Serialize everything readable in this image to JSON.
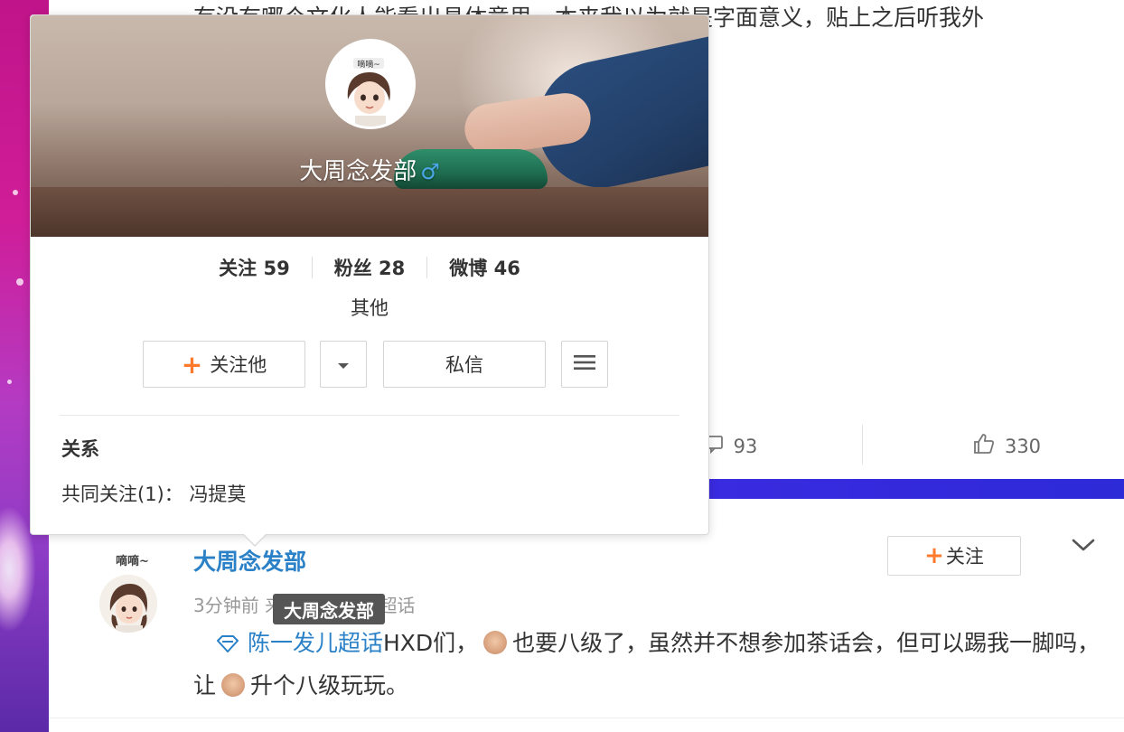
{
  "post": {
    "text_top": "有没有哪个文化人能看出具体意思，本来我以为就是字面意义，贴上之后听我外",
    "comment_count": "93",
    "like_count": "330"
  },
  "comment": {
    "avatar_tag": "嘀嘀~",
    "username": "大周念发部",
    "meta": "3分钟前 来自 陈一发儿超话",
    "tooltip": "大周念发部",
    "follow_label": "关注",
    "topic": "陈一发儿超话",
    "text_part1": "HXD们，",
    "text_part2": "也要八级了，虽然并不想参加茶话会，但可以踢我一脚吗，让",
    "text_part3": "升个八级玩玩。"
  },
  "card": {
    "avatar_tag": "嘀嘀~",
    "name": "大周念发部",
    "gender_symbol": "♂",
    "stats": [
      {
        "label": "关注",
        "value": "59"
      },
      {
        "label": "粉丝",
        "value": "28"
      },
      {
        "label": "微博",
        "value": "46"
      }
    ],
    "tag": "其他",
    "follow_label": "关注他",
    "message_label": "私信",
    "relation_title": "关系",
    "mutual_label": "共同关注(1)：",
    "mutual_name": "冯提莫"
  },
  "colors": {
    "link_blue": "#2a81c7",
    "accent_orange": "#ff7a2d",
    "band_blue": "#2a1fcf"
  }
}
